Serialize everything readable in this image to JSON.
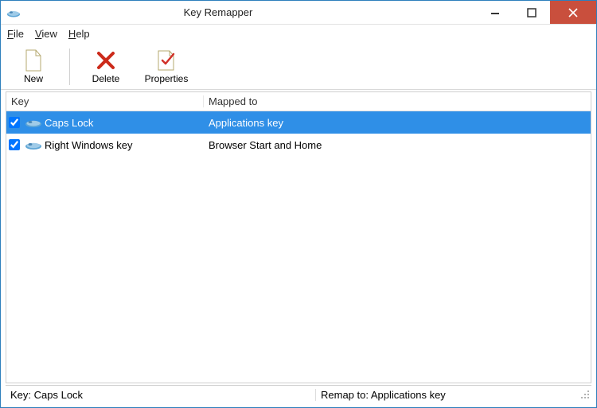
{
  "window": {
    "title": "Key Remapper"
  },
  "menubar": {
    "file": "File",
    "view": "View",
    "help": "Help"
  },
  "toolbar": {
    "new": "New",
    "delete": "Delete",
    "properties": "Properties"
  },
  "columns": {
    "key": "Key",
    "mapped": "Mapped to"
  },
  "rows": [
    {
      "checked": true,
      "key": "Caps Lock",
      "mapped": "Applications key",
      "selected": true
    },
    {
      "checked": true,
      "key": "Right Windows key",
      "mapped": "Browser Start and Home",
      "selected": false
    }
  ],
  "statusbar": {
    "left": "Key: Caps Lock",
    "right": "Remap to: Applications key"
  }
}
